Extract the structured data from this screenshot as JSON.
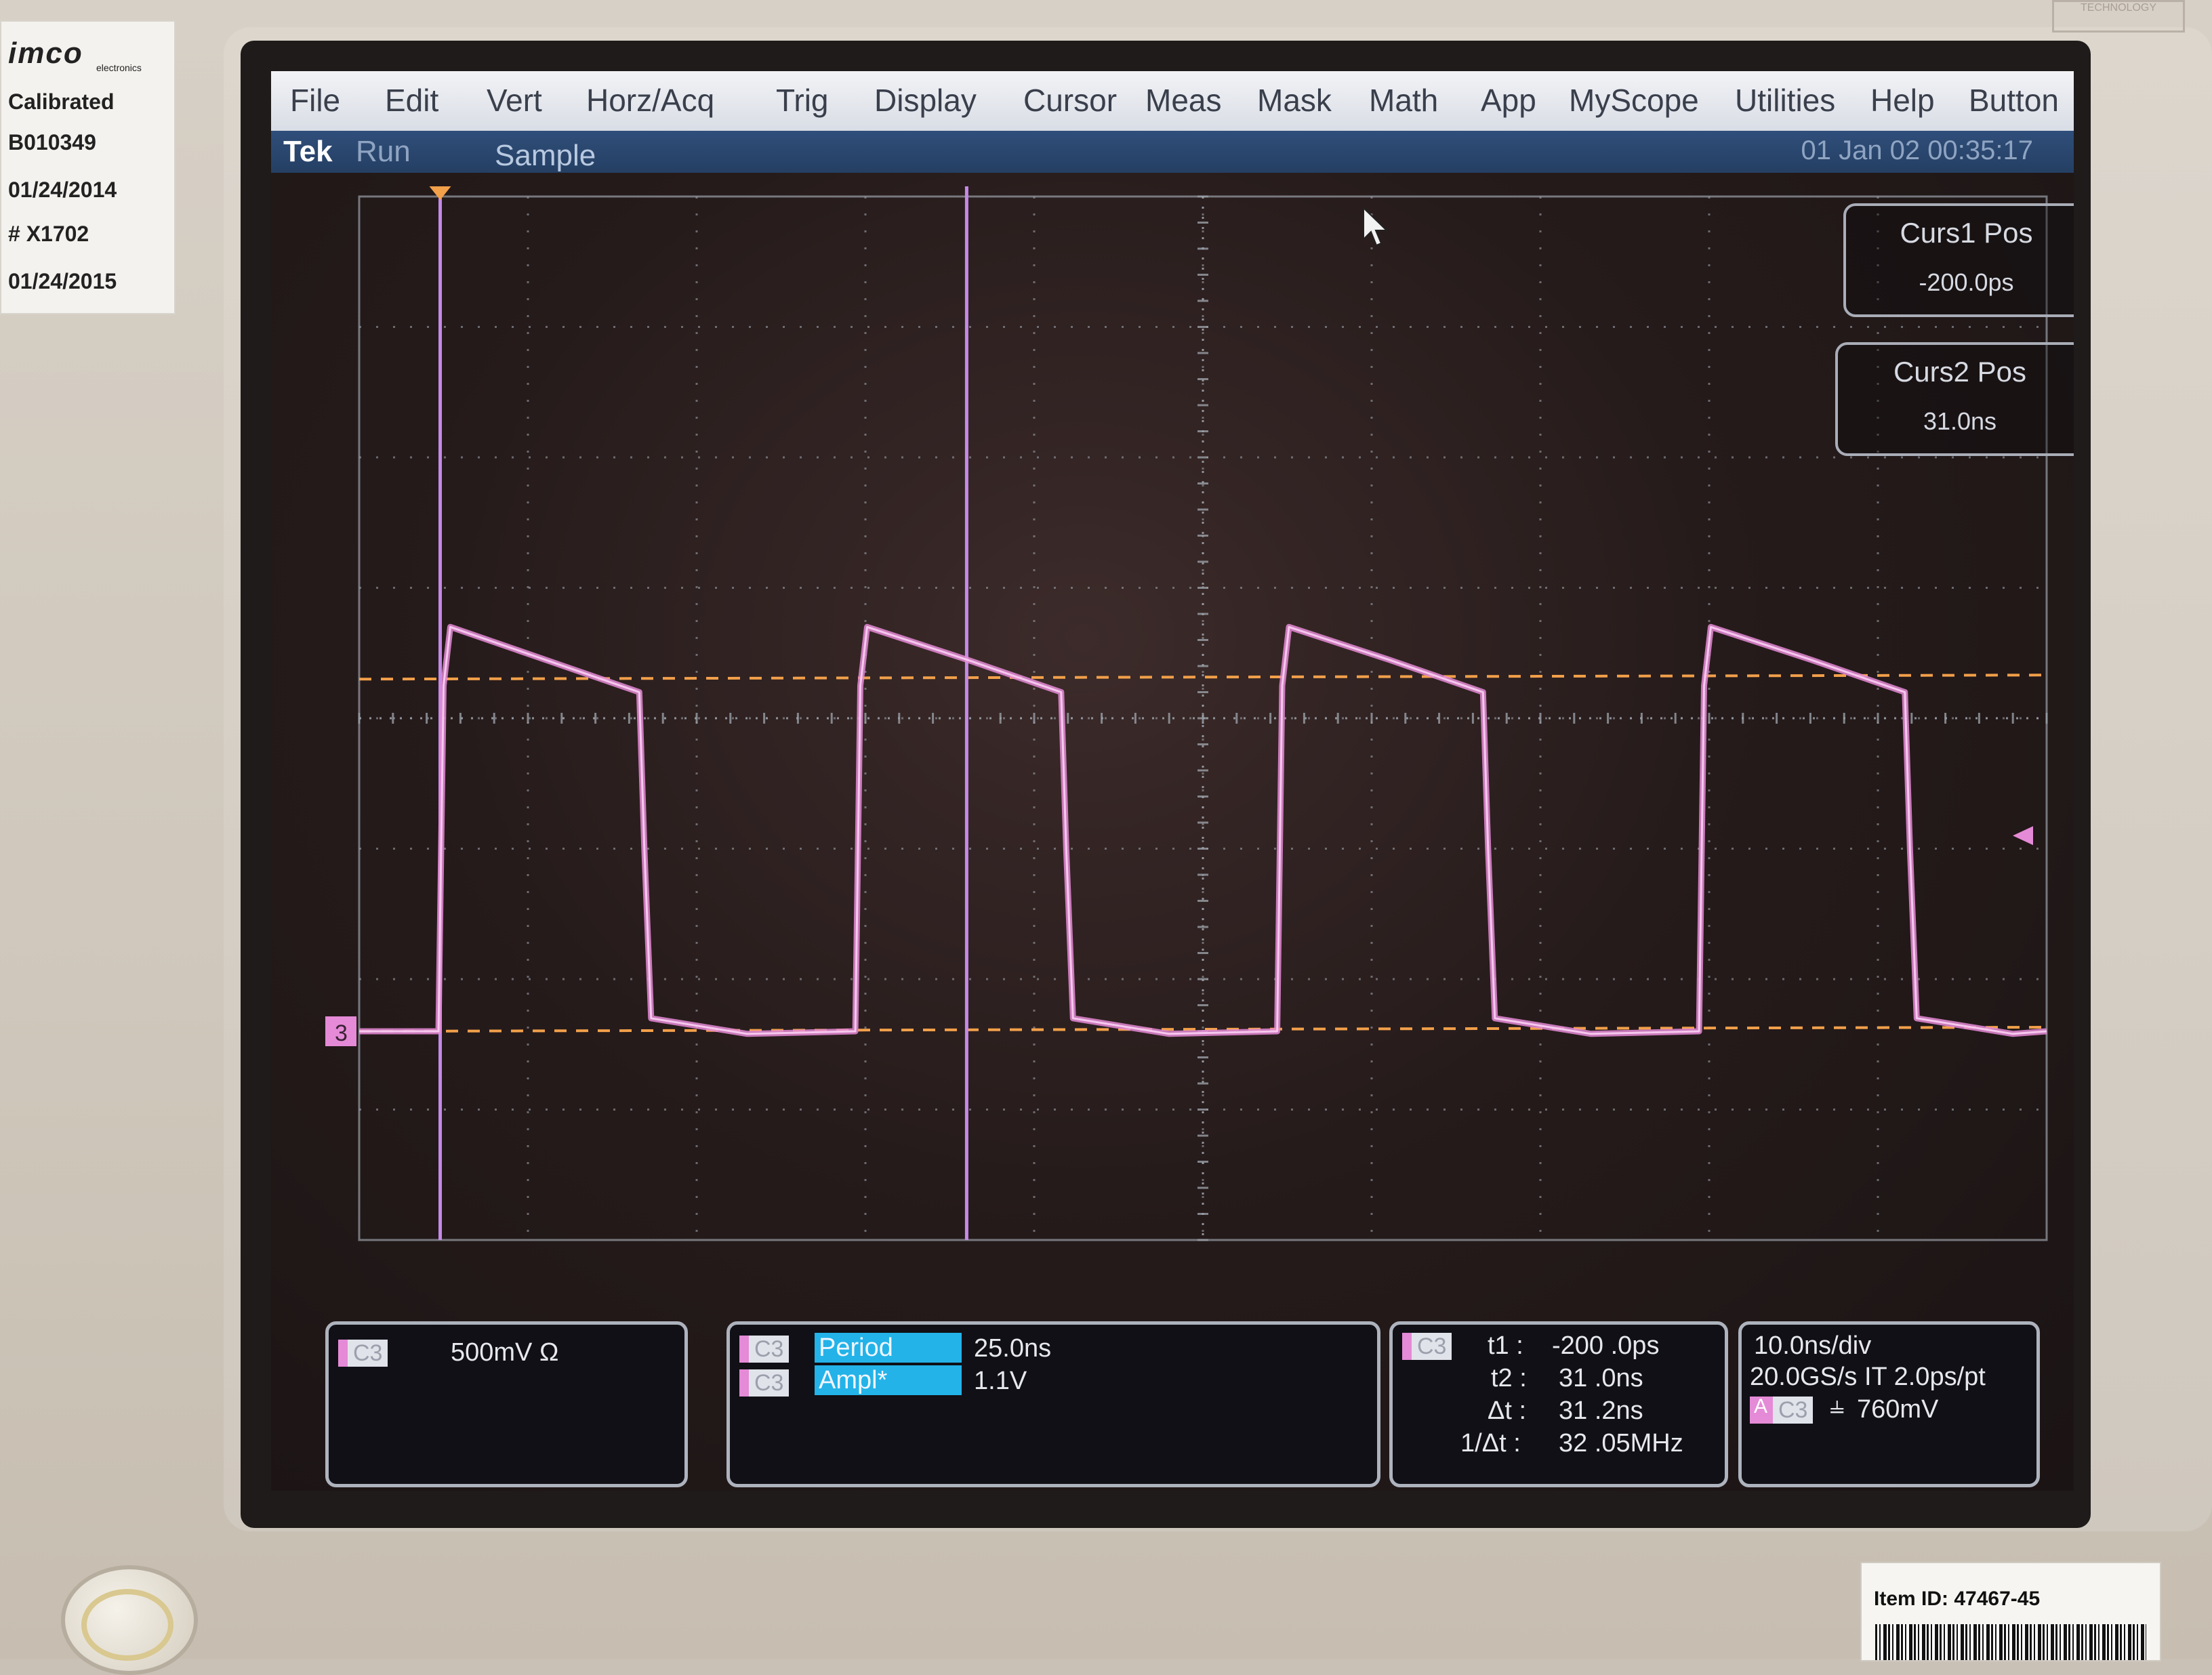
{
  "bezel": {
    "sticker": {
      "brand": "imco",
      "brand_sub": "electronics",
      "lines": [
        "Calibrated",
        "B010349",
        "01/24/2014",
        "# X1702",
        "01/24/2015"
      ]
    },
    "corner_logo": "TECHNOLOGY",
    "item_label": "Item ID:  47467-45"
  },
  "menu": [
    "File",
    "Edit",
    "Vert",
    "Horz/Acq",
    "Trig",
    "Display",
    "Cursor",
    "Meas",
    "Mask",
    "Math",
    "App",
    "MyScope",
    "Utilities",
    "Help",
    "Button"
  ],
  "status": {
    "brand": "Tek",
    "run_state": "Run",
    "acq_mode": "Sample",
    "datetime": "01 Jan 02 00:35:17"
  },
  "cursors": {
    "curs1": {
      "label": "Curs1 Pos",
      "value": "-200.0ps"
    },
    "curs2": {
      "label": "Curs2 Pos",
      "value": "31.0ns"
    }
  },
  "channel_marker": "3",
  "chart_data": {
    "type": "line",
    "title": "",
    "xlabel": "",
    "ylabel": "",
    "grid": true,
    "x_unit": "ns",
    "x_range": [
      -5,
      95
    ],
    "y_unit": "div",
    "y_range": [
      -4,
      4
    ],
    "series": [
      {
        "x": [
          -5,
          -0.3,
          0,
          0.4,
          6,
          11.6,
          11.9,
          12.3,
          18,
          24.4,
          24.7,
          25.1,
          31,
          36.6,
          36.9,
          37.3,
          43,
          49.4,
          49.7,
          50.1,
          56,
          61.6,
          61.9,
          62.3,
          68,
          74.4,
          74.7,
          75.1,
          81,
          86.6,
          86.9,
          87.3,
          93,
          95
        ],
        "y": [
          -2.4,
          -2.4,
          0.25,
          0.7,
          0.45,
          0.2,
          -1.0,
          -2.3,
          -2.42,
          -2.4,
          0.25,
          0.7,
          0.45,
          0.2,
          -1.0,
          -2.3,
          -2.42,
          -2.4,
          0.25,
          0.7,
          0.45,
          0.2,
          -1.0,
          -2.3,
          -2.42,
          -2.4,
          0.25,
          0.7,
          0.45,
          0.2,
          -1.0,
          -2.3,
          -2.42,
          -2.4
        ]
      }
    ],
    "cursor_lines_x": [
      -0.2,
      31.0
    ],
    "level_lines_y": [
      0.3,
      -2.4
    ]
  },
  "panels": {
    "channel": {
      "chip": "C3",
      "scale": "500mV Ω"
    },
    "measurements": [
      {
        "chip": "C3",
        "name": "Period",
        "value": "25.0ns"
      },
      {
        "chip": "C3",
        "name": "Ampl*",
        "value": "1.1V"
      }
    ],
    "cursor_readout": {
      "chip": "C3",
      "rows": [
        {
          "label": "t1 :",
          "value": "-200 .0ps"
        },
        {
          "label": "t2 :",
          "value": "31 .0ns"
        },
        {
          "label": "Δt :",
          "value": "31 .2ns"
        },
        {
          "label": "1/Δt :",
          "value": "32 .05MHz"
        }
      ]
    },
    "timebase": {
      "line1": "10.0ns/div",
      "line2": "20.0GS/s IT 2.0ps/pt",
      "trigger_chip": "C3",
      "trigger_prefix": "A",
      "trigger_level": "760mV"
    }
  },
  "colors": {
    "trace": "#e58ad6",
    "cursor_line": "#c48ae6",
    "level_line": "#f2a04a",
    "grid": "#9aa0a8",
    "highlight": "#23b3e8"
  }
}
